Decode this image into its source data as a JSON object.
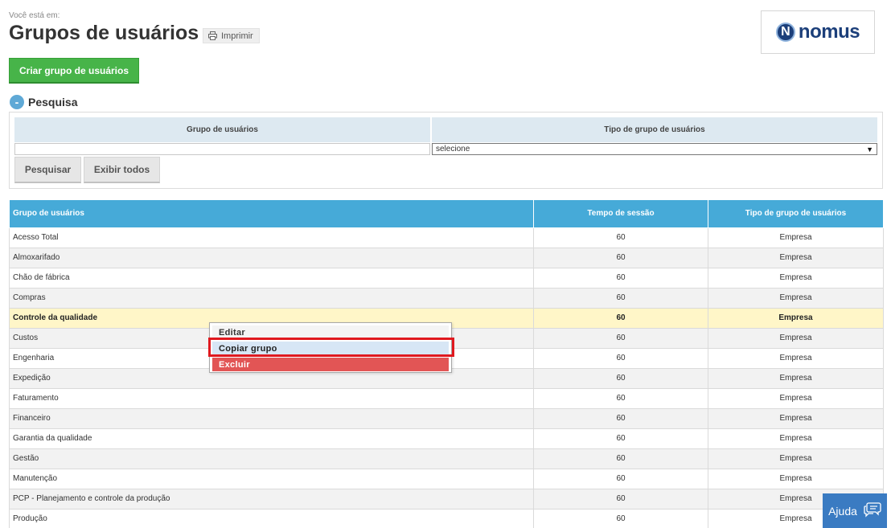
{
  "breadcrumb": "Você está em:",
  "page": {
    "title": "Grupos de usuários",
    "print_label": "Imprimir"
  },
  "logo": {
    "text": "nomus",
    "mark": "N"
  },
  "create_button": "Criar grupo de usuários",
  "search": {
    "toggle": "-",
    "title": "Pesquisa",
    "field1_label": "Grupo de usuários",
    "field1_value": "",
    "field2_label": "Tipo de grupo de usuários",
    "field2_value": "selecione",
    "search_button": "Pesquisar",
    "show_all_button": "Exibir todos"
  },
  "table": {
    "headers": [
      "Grupo de usuários",
      "Tempo de sessão",
      "Tipo de grupo de usuários"
    ],
    "rows": [
      {
        "name": "Acesso Total",
        "session": "60",
        "type": "Empresa"
      },
      {
        "name": "Almoxarifado",
        "session": "60",
        "type": "Empresa"
      },
      {
        "name": "Chão de fábrica",
        "session": "60",
        "type": "Empresa"
      },
      {
        "name": "Compras",
        "session": "60",
        "type": "Empresa"
      },
      {
        "name": "Controle da qualidade",
        "session": "60",
        "type": "Empresa"
      },
      {
        "name": "Custos",
        "session": "60",
        "type": "Empresa"
      },
      {
        "name": "Engenharia",
        "session": "60",
        "type": "Empresa"
      },
      {
        "name": "Expedição",
        "session": "60",
        "type": "Empresa"
      },
      {
        "name": "Faturamento",
        "session": "60",
        "type": "Empresa"
      },
      {
        "name": "Financeiro",
        "session": "60",
        "type": "Empresa"
      },
      {
        "name": "Garantia da qualidade",
        "session": "60",
        "type": "Empresa"
      },
      {
        "name": "Gestão",
        "session": "60",
        "type": "Empresa"
      },
      {
        "name": "Manutenção",
        "session": "60",
        "type": "Empresa"
      },
      {
        "name": "PCP - Planejamento e controle da produção",
        "session": "60",
        "type": "Empresa"
      },
      {
        "name": "Produção",
        "session": "60",
        "type": "Empresa"
      }
    ]
  },
  "context_menu": {
    "items": [
      "Editar",
      "Copiar grupo",
      "Excluir"
    ]
  },
  "help_button": "Ajuda"
}
